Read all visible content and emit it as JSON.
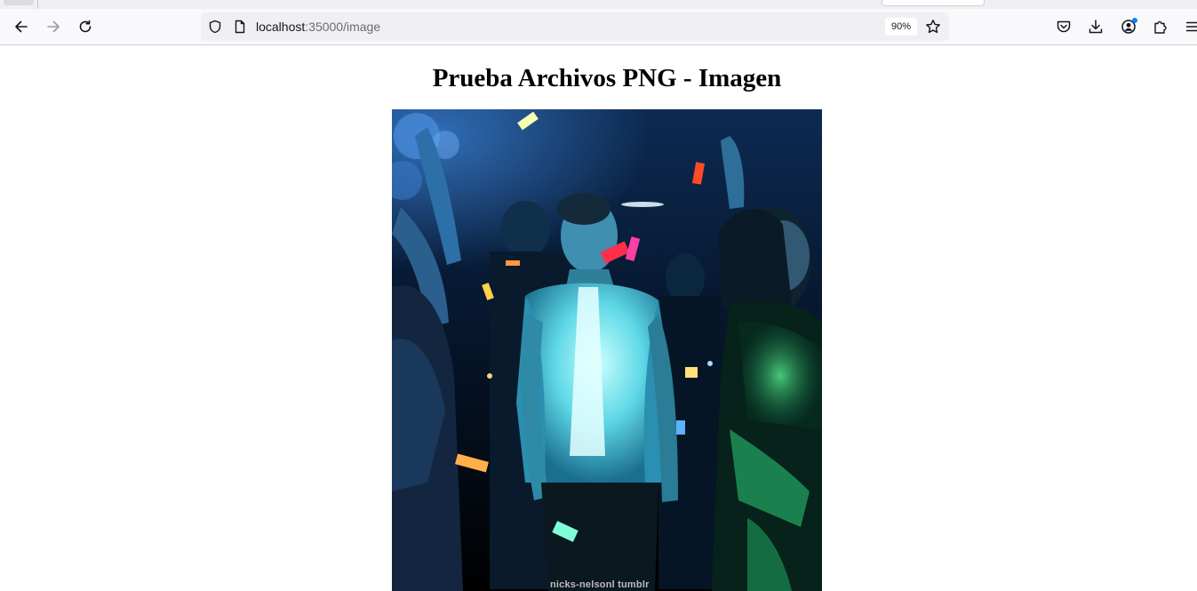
{
  "browser": {
    "url_host": "localhost",
    "url_path": ":35000/image",
    "zoom_level": "90%",
    "icons": {
      "back": "back-arrow-icon",
      "forward": "forward-arrow-icon",
      "reload": "reload-icon",
      "shield": "tracking-protection-shield-icon",
      "page": "page-document-icon",
      "bookmark": "bookmark-star-icon",
      "pocket": "pocket-icon",
      "downloads": "download-icon",
      "account": "account-icon",
      "extensions": "extensions-puzzle-icon",
      "menu": "hamburger-menu-icon"
    },
    "accent_color": "#0a84ff"
  },
  "page": {
    "title": "Prueba Archivos PNG - Imagen",
    "image": {
      "watermark": "nicks-nelsonl tumblr"
    }
  }
}
